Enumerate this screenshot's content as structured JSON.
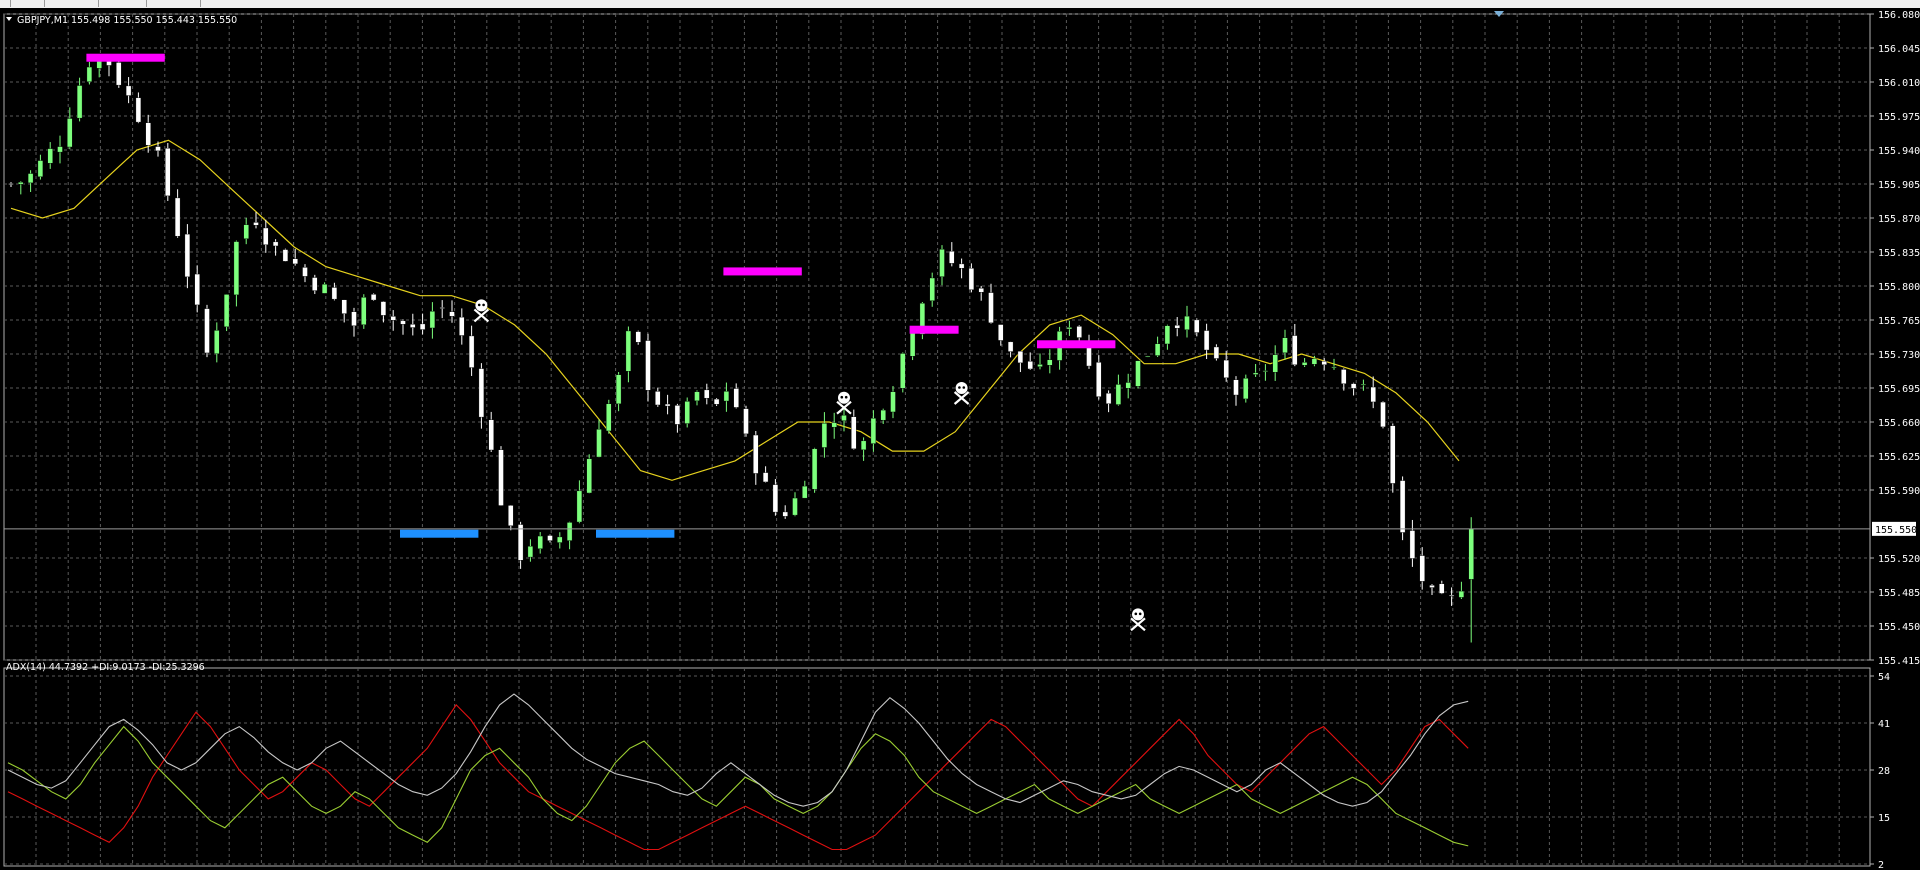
{
  "symbol_header": "GBPJPY,M1  155.498 155.550 155.443 155.550",
  "indicator_header": "ADX(14) 44.7392 +DI:9.0173 -DI:25.3296",
  "colors": {
    "background": "#000000",
    "grid": "#5a5a5a",
    "bull_candle": "#7dff7d",
    "bear_candle": "#ffffff",
    "moving_average": "#e6d21e",
    "resistance_zone": "#ff00ff",
    "support_zone": "#1e90ff",
    "adx_line": "#c8c8c8",
    "plus_di_line": "#9acd32",
    "minus_di_line": "#e01010",
    "price_label_bg": "#ffffff"
  },
  "icons": {
    "signal_marker": "skull-crossbones-icon",
    "dropdown": "triangle-down-icon"
  },
  "price_axis": {
    "ticks": [
      "156.080",
      "156.045",
      "156.010",
      "155.975",
      "155.940",
      "155.905",
      "155.870",
      "155.835",
      "155.800",
      "155.765",
      "155.730",
      "155.695",
      "155.660",
      "155.625",
      "155.590",
      "155.520",
      "155.485",
      "155.450",
      "155.415"
    ],
    "current_price": "155.550"
  },
  "adx_axis": {
    "ticks": [
      "54",
      "41",
      "28",
      "15",
      "2"
    ]
  },
  "chart_data": {
    "type": "candlestick",
    "symbol": "GBPJPY",
    "timeframe": "M1",
    "ylim": [
      155.415,
      156.08
    ],
    "grid": true,
    "last_bar": {
      "open": 155.498,
      "high": 155.55,
      "low": 155.443,
      "close": 155.55
    },
    "close_path": [
      155.905,
      155.91,
      155.93,
      155.95,
      156.0,
      156.04,
      156.03,
      156.0,
      155.97,
      155.93,
      155.87,
      155.8,
      155.73,
      155.78,
      155.86,
      155.87,
      155.84,
      155.83,
      155.81,
      155.8,
      155.78,
      155.76,
      155.8,
      155.77,
      155.76,
      155.75,
      155.78,
      155.77,
      155.73,
      155.66,
      155.58,
      155.52,
      155.54,
      155.53,
      155.55,
      155.6,
      155.66,
      155.69,
      155.76,
      155.7,
      155.67,
      155.66,
      155.69,
      155.67,
      155.7,
      155.64,
      155.6,
      155.56,
      155.58,
      155.62,
      155.67,
      155.66,
      155.63,
      155.67,
      155.7,
      155.75,
      155.8,
      155.83,
      155.82,
      155.8,
      155.77,
      155.73,
      155.72,
      155.71,
      155.74,
      155.77,
      155.72,
      155.68,
      155.7,
      155.72,
      155.74,
      155.77,
      155.76,
      155.74,
      155.71,
      155.69,
      155.7,
      155.72,
      155.74,
      155.72,
      155.73,
      155.72,
      155.7,
      155.69,
      155.66,
      155.55,
      155.51,
      155.48,
      155.47,
      155.5,
      155.55
    ],
    "moving_average_path": [
      155.88,
      155.87,
      155.88,
      155.91,
      155.94,
      155.95,
      155.93,
      155.9,
      155.87,
      155.84,
      155.82,
      155.81,
      155.8,
      155.79,
      155.79,
      155.78,
      155.76,
      155.73,
      155.69,
      155.65,
      155.61,
      155.6,
      155.61,
      155.62,
      155.64,
      155.66,
      155.66,
      155.65,
      155.63,
      155.63,
      155.65,
      155.69,
      155.73,
      155.76,
      155.77,
      155.75,
      155.72,
      155.72,
      155.73,
      155.73,
      155.72,
      155.73,
      155.72,
      155.71,
      155.69,
      155.66,
      155.62
    ],
    "resistance_zones": [
      {
        "from_bar": 8,
        "to_bar": 16,
        "price": 156.035
      },
      {
        "from_bar": 73,
        "to_bar": 81,
        "price": 155.815
      },
      {
        "from_bar": 92,
        "to_bar": 97,
        "price": 155.755
      },
      {
        "from_bar": 105,
        "to_bar": 113,
        "price": 155.74
      }
    ],
    "support_zones": [
      {
        "from_bar": 40,
        "to_bar": 48,
        "price": 155.545
      },
      {
        "from_bar": 60,
        "to_bar": 68,
        "price": 155.545
      }
    ],
    "signal_markers": [
      {
        "bar": 48,
        "price": 155.78
      },
      {
        "bar": 85,
        "price": 155.685
      },
      {
        "bar": 97,
        "price": 155.695
      },
      {
        "bar": 115,
        "price": 155.462
      }
    ],
    "adx": {
      "ylim": [
        2,
        54
      ],
      "adx": [
        28,
        26,
        24,
        23,
        25,
        30,
        35,
        40,
        42,
        39,
        35,
        30,
        28,
        30,
        34,
        38,
        40,
        37,
        33,
        30,
        28,
        30,
        34,
        36,
        33,
        30,
        27,
        24,
        22,
        21,
        23,
        27,
        33,
        40,
        46,
        49,
        46,
        42,
        38,
        34,
        31,
        29,
        27,
        26,
        25,
        24,
        22,
        21,
        23,
        27,
        30,
        27,
        24,
        21,
        19,
        18,
        19,
        22,
        28,
        36,
        44,
        48,
        45,
        41,
        36,
        31,
        27,
        24,
        22,
        20,
        19,
        21,
        23,
        25,
        24,
        22,
        21,
        20,
        21,
        24,
        27,
        29,
        28,
        26,
        24,
        22,
        24,
        28,
        30,
        27,
        24,
        21,
        19,
        18,
        19,
        22,
        27,
        32,
        38,
        43,
        46,
        47
      ],
      "plus_di": [
        30,
        28,
        25,
        22,
        20,
        24,
        30,
        35,
        40,
        36,
        30,
        26,
        22,
        18,
        14,
        12,
        16,
        20,
        24,
        26,
        22,
        18,
        16,
        18,
        22,
        20,
        16,
        12,
        10,
        8,
        12,
        20,
        28,
        32,
        34,
        30,
        26,
        20,
        16,
        14,
        18,
        24,
        30,
        34,
        36,
        32,
        28,
        24,
        20,
        18,
        22,
        26,
        24,
        20,
        18,
        16,
        18,
        22,
        28,
        34,
        38,
        36,
        32,
        26,
        22,
        20,
        18,
        16,
        18,
        20,
        22,
        24,
        20,
        18,
        16,
        18,
        20,
        22,
        24,
        20,
        18,
        16,
        18,
        20,
        22,
        24,
        20,
        18,
        16,
        18,
        20,
        22,
        24,
        26,
        24,
        20,
        16,
        14,
        12,
        10,
        8,
        7
      ],
      "minus_di": [
        22,
        20,
        18,
        16,
        14,
        12,
        10,
        8,
        12,
        18,
        26,
        32,
        38,
        44,
        40,
        34,
        28,
        24,
        20,
        22,
        26,
        30,
        28,
        24,
        20,
        18,
        22,
        26,
        30,
        34,
        40,
        46,
        42,
        36,
        30,
        26,
        22,
        20,
        18,
        16,
        14,
        12,
        10,
        8,
        6,
        6,
        8,
        10,
        12,
        14,
        16,
        18,
        16,
        14,
        12,
        10,
        8,
        6,
        6,
        8,
        10,
        14,
        18,
        22,
        26,
        30,
        34,
        38,
        42,
        40,
        36,
        32,
        28,
        24,
        20,
        18,
        22,
        26,
        30,
        34,
        38,
        42,
        38,
        32,
        28,
        24,
        22,
        26,
        30,
        34,
        38,
        40,
        36,
        32,
        28,
        24,
        28,
        34,
        40,
        42,
        38,
        34
      ]
    }
  }
}
